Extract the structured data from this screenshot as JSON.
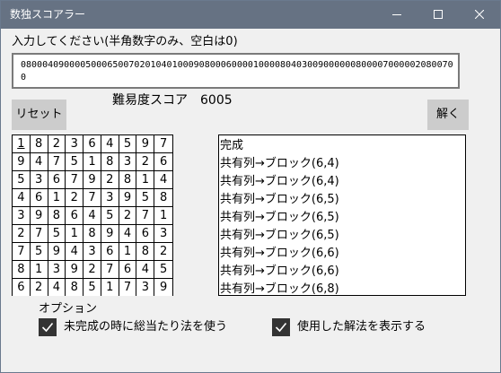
{
  "window": {
    "title": "数独スコアラー"
  },
  "prompt": "入力してください(半角数字のみ、空白は0)",
  "input_value": "080004090000500065007020104010009080006000010000804030090000008000070000020800700",
  "buttons": {
    "reset": "リセット",
    "solve": "解く"
  },
  "difficulty": {
    "label": "難易度スコア",
    "value": "6005"
  },
  "grid": [
    [
      "1",
      "8",
      "2",
      "3",
      "6",
      "4",
      "5",
      "9",
      "7"
    ],
    [
      "9",
      "4",
      "7",
      "5",
      "1",
      "8",
      "3",
      "2",
      "6"
    ],
    [
      "5",
      "3",
      "6",
      "7",
      "9",
      "2",
      "8",
      "1",
      "4"
    ],
    [
      "4",
      "6",
      "1",
      "2",
      "7",
      "3",
      "9",
      "5",
      "8"
    ],
    [
      "3",
      "9",
      "8",
      "6",
      "4",
      "5",
      "2",
      "7",
      "1"
    ],
    [
      "2",
      "7",
      "5",
      "1",
      "8",
      "9",
      "4",
      "6",
      "3"
    ],
    [
      "7",
      "5",
      "9",
      "4",
      "3",
      "6",
      "1",
      "8",
      "2"
    ],
    [
      "8",
      "1",
      "3",
      "9",
      "2",
      "7",
      "6",
      "4",
      "5"
    ],
    [
      "6",
      "2",
      "4",
      "8",
      "5",
      "1",
      "7",
      "3",
      "9"
    ]
  ],
  "log": [
    "完成",
    "共有列→ブロック(6,4)",
    "共有列→ブロック(6,4)",
    "共有列→ブロック(6,5)",
    "共有列→ブロック(6,5)",
    "共有列→ブロック(6,5)",
    "共有列→ブロック(6,6)",
    "共有列→ブロック(6,6)",
    "共有列→ブロック(6,8)"
  ],
  "options": {
    "label": "オプション",
    "use_brute_force": {
      "label": "未完成の時に総当たり法を使う",
      "checked": true
    },
    "show_techniques": {
      "label": "使用した解法を表示する",
      "checked": true
    }
  }
}
